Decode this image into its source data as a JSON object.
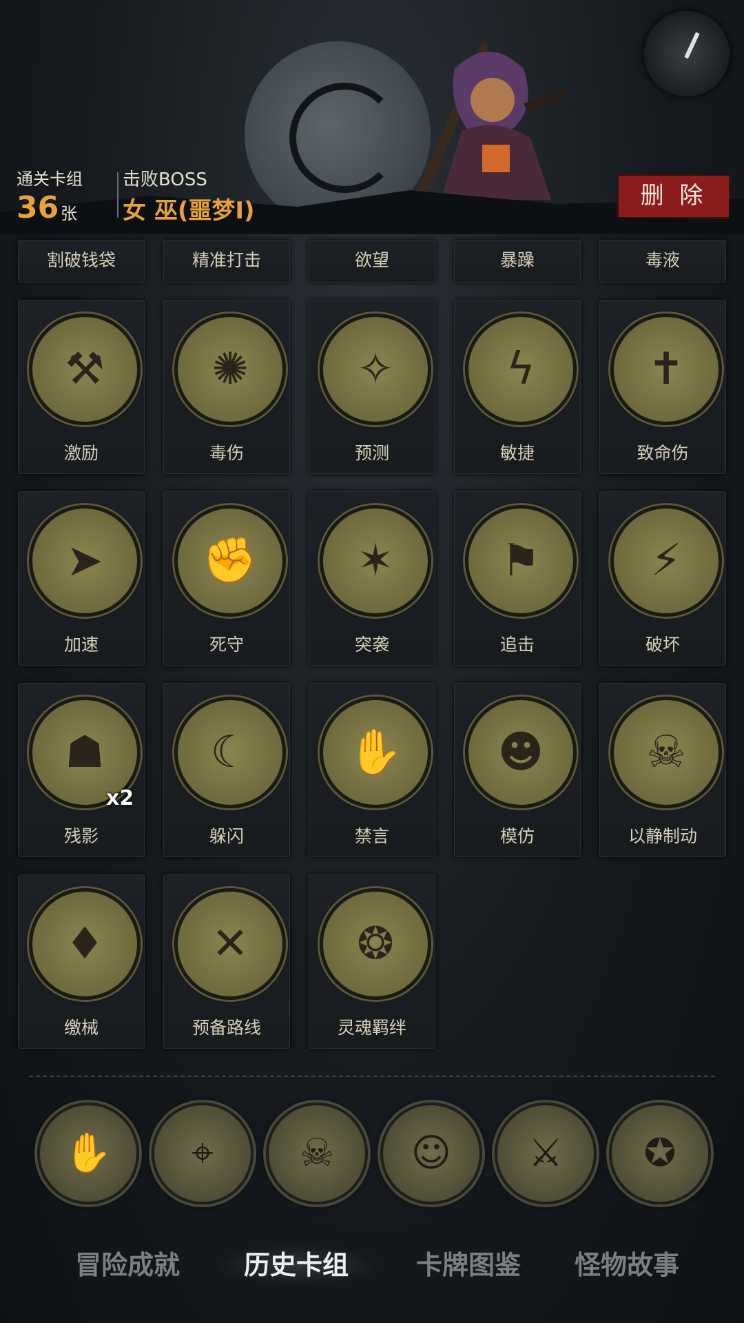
{
  "header": {
    "deck_label": "通关卡组",
    "deck_count": "36",
    "deck_unit": "张",
    "boss_label": "击败BOSS",
    "boss_name": "女 巫(噩梦I)",
    "delete_label": "删 除"
  },
  "cards_partial": [
    {
      "name": "割破钱袋"
    },
    {
      "name": "精准打击"
    },
    {
      "name": "欲望"
    },
    {
      "name": "暴躁"
    },
    {
      "name": "毒液"
    }
  ],
  "cards": [
    {
      "name": "激励",
      "icon": "hammer-icon"
    },
    {
      "name": "毒伤",
      "icon": "poison-octopus-icon"
    },
    {
      "name": "预测",
      "icon": "witch-crystal-ball-icon"
    },
    {
      "name": "敏捷",
      "icon": "panther-lightning-icon"
    },
    {
      "name": "致命伤",
      "icon": "bleeding-dagger-icon"
    },
    {
      "name": "加速",
      "icon": "running-witch-icon"
    },
    {
      "name": "死守",
      "icon": "brute-guard-icon"
    },
    {
      "name": "突袭",
      "icon": "ambush-hunter-icon"
    },
    {
      "name": "追击",
      "icon": "chasing-rogue-icon"
    },
    {
      "name": "破坏",
      "icon": "shattered-bolt-icon"
    },
    {
      "name": "残影",
      "icon": "afterimage-monks-icon",
      "badge": "x2"
    },
    {
      "name": "躲闪",
      "icon": "dodging-girl-icon"
    },
    {
      "name": "禁言",
      "icon": "silence-hood-icon"
    },
    {
      "name": "模仿",
      "icon": "goblin-mask-icon"
    },
    {
      "name": "以静制动",
      "icon": "skull-flame-icon"
    },
    {
      "name": "缴械",
      "icon": "disarm-shield-icon"
    },
    {
      "name": "预备路线",
      "icon": "treasure-map-icon"
    },
    {
      "name": "灵魂羁绊",
      "icon": "soul-bond-icon"
    }
  ],
  "bottom_icons": [
    {
      "name": "cards-hand-icon",
      "glyph": "✋"
    },
    {
      "name": "spyglass-icon",
      "glyph": "⌖"
    },
    {
      "name": "reaper-skull-icon",
      "glyph": "☠"
    },
    {
      "name": "bearded-pirate-icon",
      "glyph": "☺"
    },
    {
      "name": "hooded-rogue-icon",
      "glyph": "⚔"
    },
    {
      "name": "pumpkin-scarecrow-icon",
      "glyph": "✪"
    }
  ],
  "tabs": [
    {
      "label": "冒险成就",
      "active": false
    },
    {
      "label": "历史卡组",
      "active": true
    },
    {
      "label": "卡牌图鉴",
      "active": false
    },
    {
      "label": "怪物故事",
      "active": false
    }
  ]
}
